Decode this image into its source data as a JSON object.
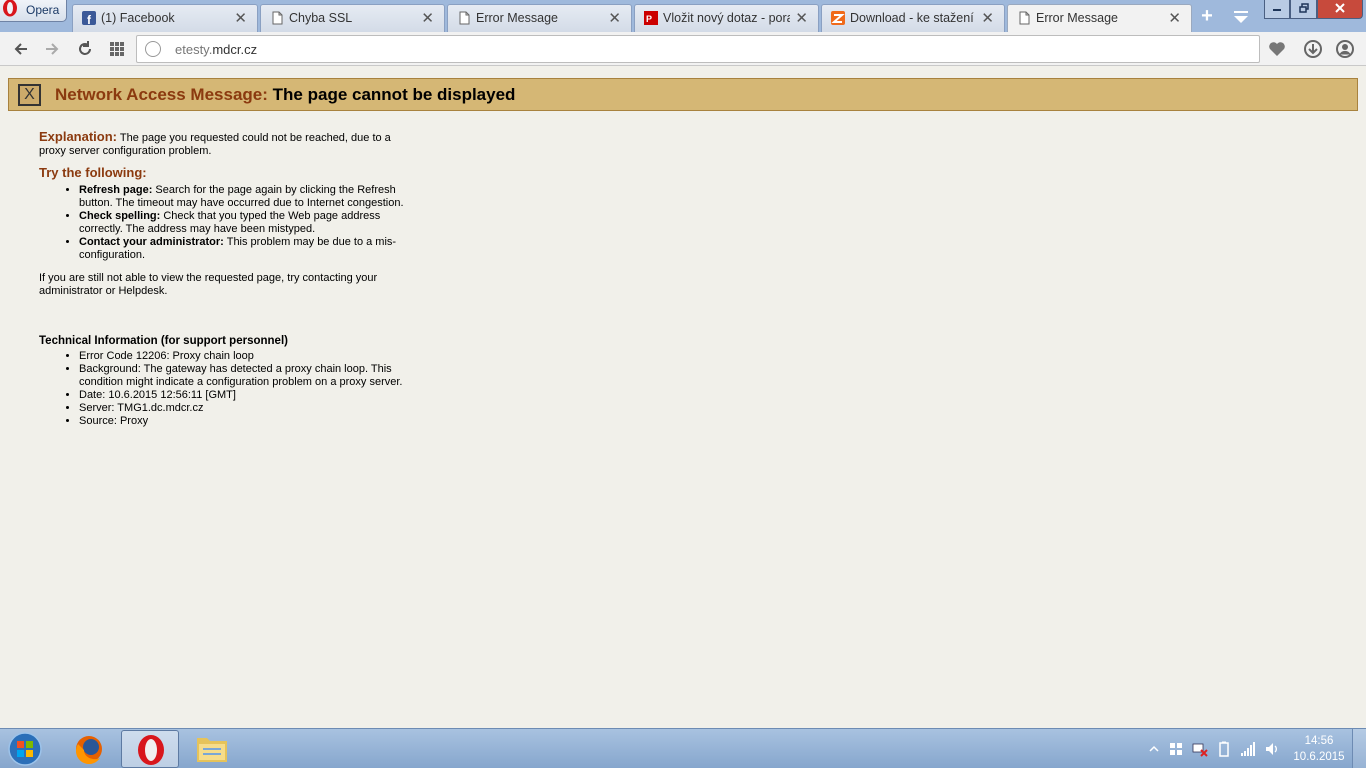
{
  "browser": {
    "menu_label": "Opera",
    "tabs": [
      {
        "title": "(1) Facebook",
        "icon": "facebook-icon"
      },
      {
        "title": "Chyba SSL",
        "icon": "page-icon"
      },
      {
        "title": "Error Message",
        "icon": "page-icon"
      },
      {
        "title": "Vložit nový dotaz - poradna",
        "icon": "pcnet-icon"
      },
      {
        "title": "Download - ke stažení zdarma",
        "icon": "zive-icon"
      },
      {
        "title": "Error Message",
        "icon": "page-icon",
        "active": true
      }
    ],
    "url_prefix": "etesty.",
    "url_domain": "mdcr.cz"
  },
  "page": {
    "banner_prefix": "Network Access Message:",
    "banner_title": "The page cannot be displayed",
    "banner_icon_text": "X",
    "explanation_label": "Explanation:",
    "explanation_text": "The page you requested could not be reached, due to a proxy server configuration problem.",
    "try_heading": "Try the following:",
    "suggestions": [
      {
        "label": "Refresh page:",
        "text": "Search for the page again by clicking the Refresh button. The timeout may have occurred due to Internet congestion."
      },
      {
        "label": "Check spelling:",
        "text": "Check that you typed the Web page address correctly. The address may have been mistyped."
      },
      {
        "label": "Contact your administrator:",
        "text": "This problem may be due to a mis-configuration."
      }
    ],
    "still_text": "If you are still not able to view the requested page, try contacting your administrator or Helpdesk.",
    "tech_heading": "Technical Information (for support personnel)",
    "tech_items": [
      "Error Code 12206: Proxy chain loop",
      "Background: The gateway has detected a proxy chain loop. This condition might indicate a configuration problem on a proxy server.",
      "Date: 10.6.2015 12:56:11 [GMT]",
      "Server: TMG1.dc.mdcr.cz",
      "Source: Proxy"
    ]
  },
  "taskbar": {
    "time": "14:56",
    "date": "10.6.2015"
  },
  "colors": {
    "banner_bg": "#d5b775",
    "heading": "#8b3a0f",
    "page_bg": "#f1f0ea"
  }
}
